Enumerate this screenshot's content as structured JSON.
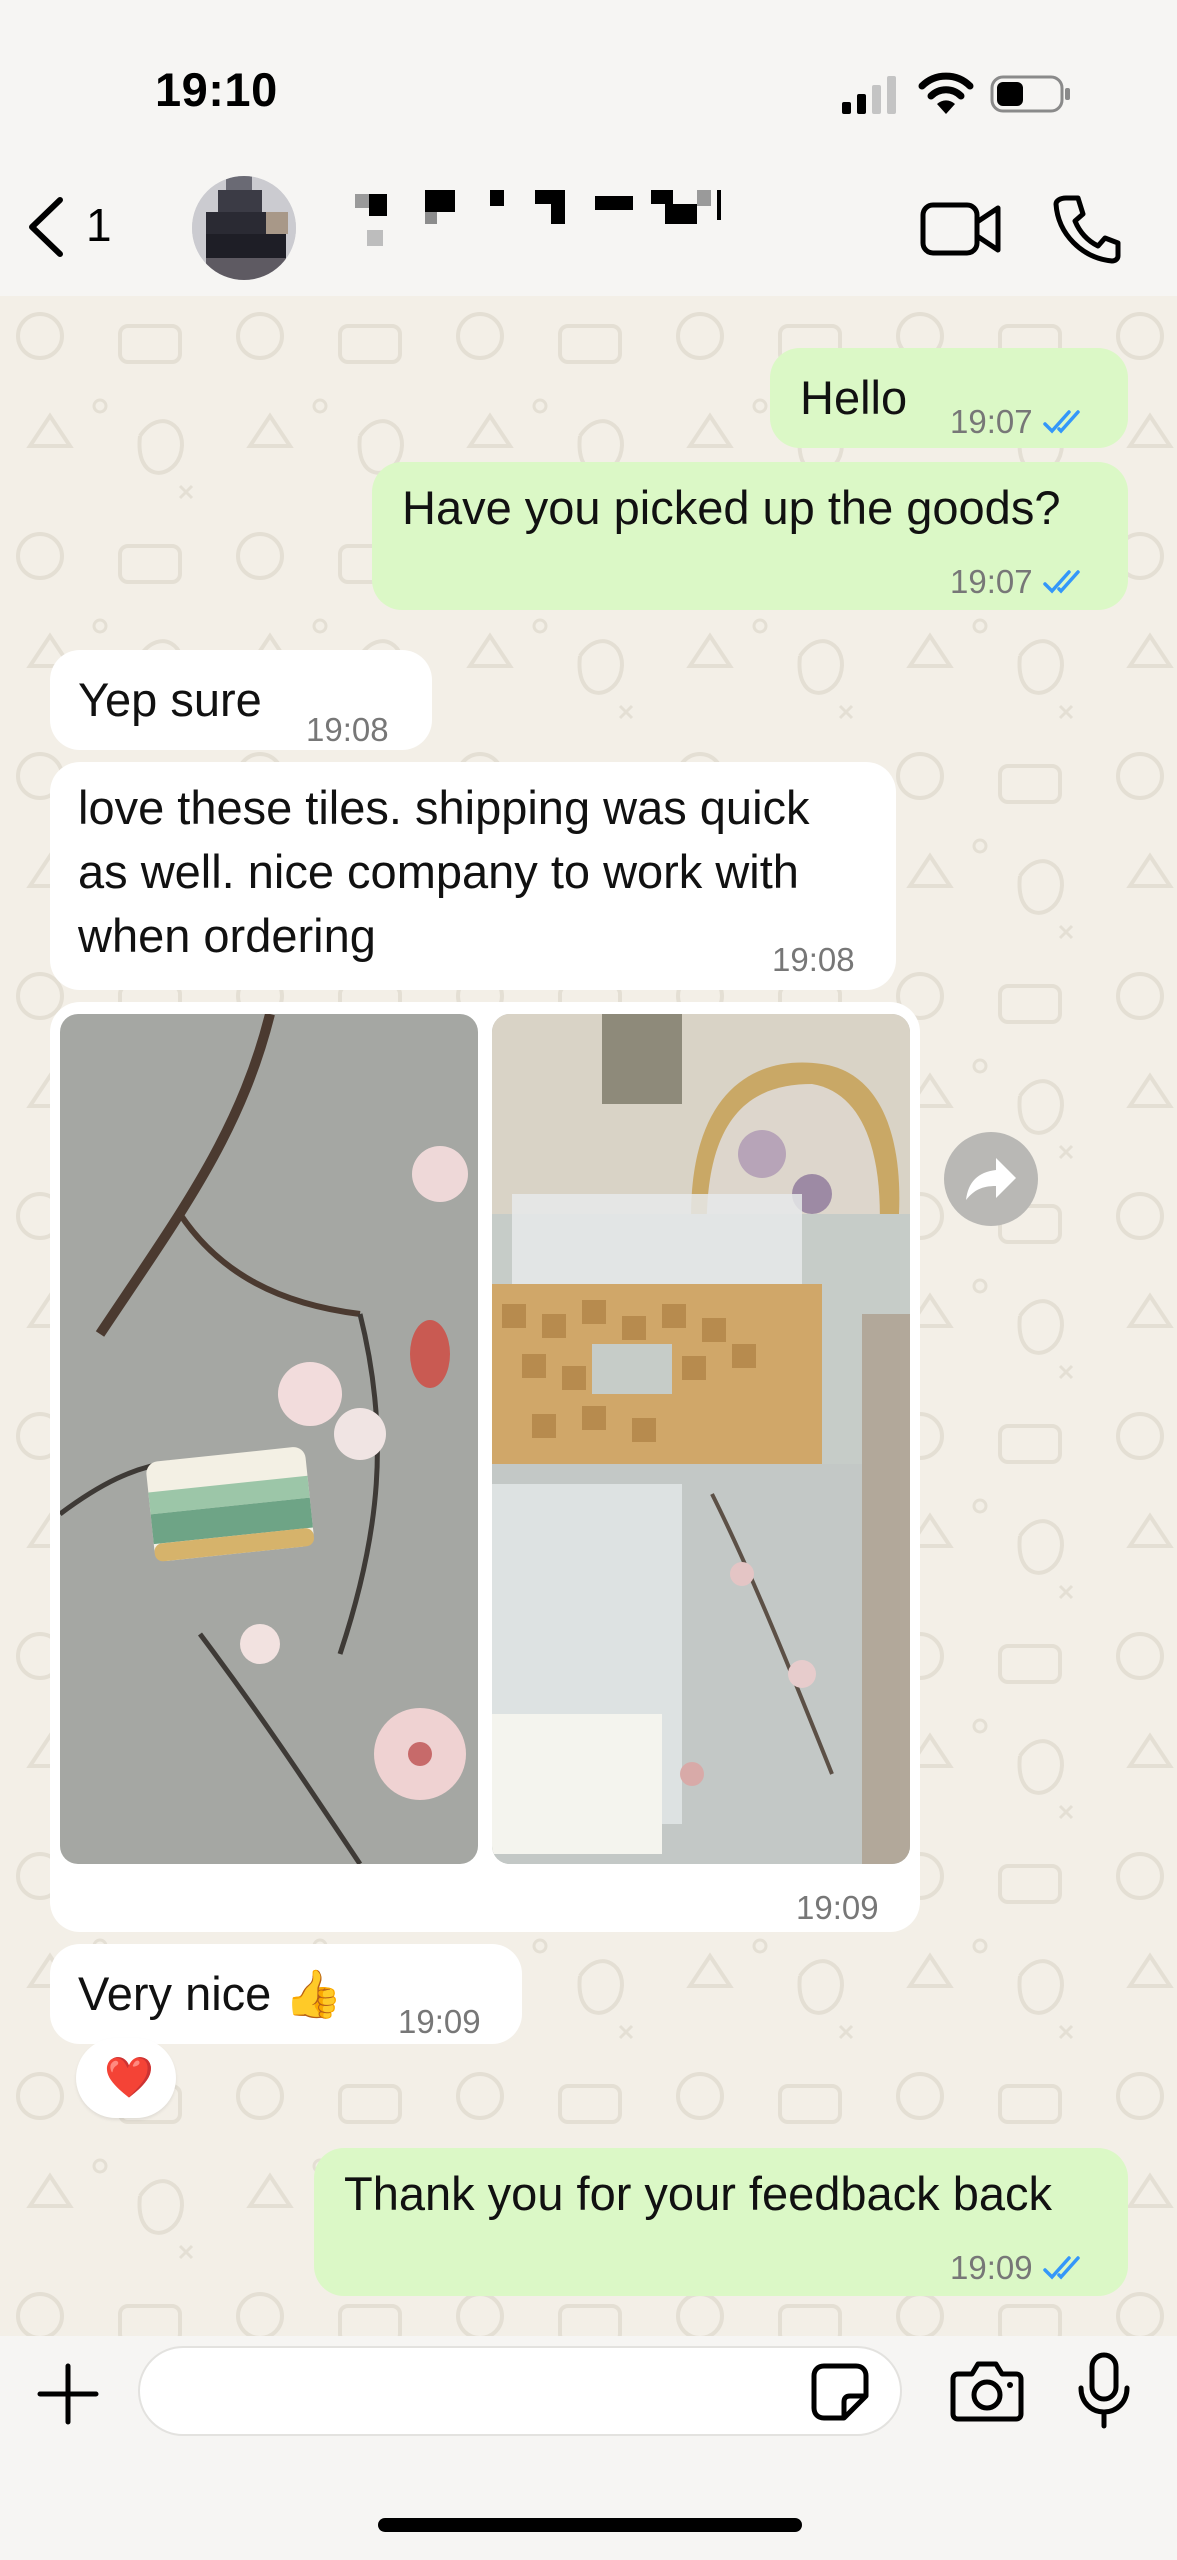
{
  "status_bar": {
    "time": "19:10"
  },
  "header": {
    "back_count": "1"
  },
  "messages": [
    {
      "id": "m1",
      "direction": "outgoing",
      "text": "Hello",
      "time": "19:07",
      "read": true
    },
    {
      "id": "m2",
      "direction": "outgoing",
      "text": "Have you picked up the goods?",
      "time": "19:07",
      "read": true
    },
    {
      "id": "m3",
      "direction": "incoming",
      "text": "Yep sure",
      "time": "19:08"
    },
    {
      "id": "m4",
      "direction": "incoming",
      "lines": [
        "love these tiles. shipping was quick",
        "as well. nice company to work with",
        "when ordering"
      ],
      "time": "19:08"
    },
    {
      "id": "m5",
      "direction": "incoming",
      "type": "photos",
      "photo_count": 2,
      "time": "19:09"
    },
    {
      "id": "m6",
      "direction": "incoming",
      "text": "Very nice 👍",
      "time": "19:09",
      "reaction": "❤️"
    },
    {
      "id": "m7",
      "direction": "outgoing",
      "text": "Thank you for your feedback back",
      "time": "19:09",
      "read": true
    }
  ],
  "composer": {
    "placeholder": ""
  },
  "colors": {
    "outgoing_bubble": "#dbf8c6",
    "incoming_bubble": "#ffffff",
    "read_ticks": "#3497f9",
    "chat_background": "#f3efe7"
  },
  "icons": [
    "back-chevron-icon",
    "video-call-icon",
    "phone-icon",
    "forward-icon",
    "plus-icon",
    "sticker-icon",
    "camera-icon",
    "microphone-icon"
  ]
}
